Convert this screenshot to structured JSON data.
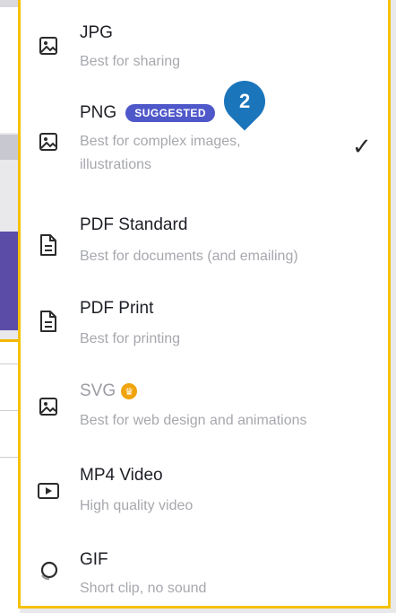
{
  "menu": {
    "items": [
      {
        "title": "JPG",
        "subtitle": "Best for sharing",
        "icon": "image-icon"
      },
      {
        "title": "PNG",
        "badge": "SUGGESTED",
        "subtitle": "Best for complex images,",
        "subtitle2": "illustrations",
        "icon": "image-icon",
        "selected": true
      },
      {
        "title": "PDF Standard",
        "subtitle": "Best for documents (and emailing)",
        "icon": "document-icon"
      },
      {
        "title": "PDF Print",
        "subtitle": "Best for printing",
        "icon": "document-icon"
      },
      {
        "title": "SVG",
        "subtitle": "Best for web design and animations",
        "icon": "image-icon",
        "premium": true
      },
      {
        "title": "MP4 Video",
        "subtitle": "High quality video",
        "icon": "video-icon"
      },
      {
        "title": "GIF",
        "subtitle": "Short clip, no sound",
        "icon": "gif-icon"
      }
    ],
    "checkmark": "✓"
  },
  "step_marker": "2",
  "colors": {
    "frame": "#f5c100",
    "badge": "#4f58c9",
    "marker": "#1b75bb",
    "crown": "#f0a40d"
  }
}
